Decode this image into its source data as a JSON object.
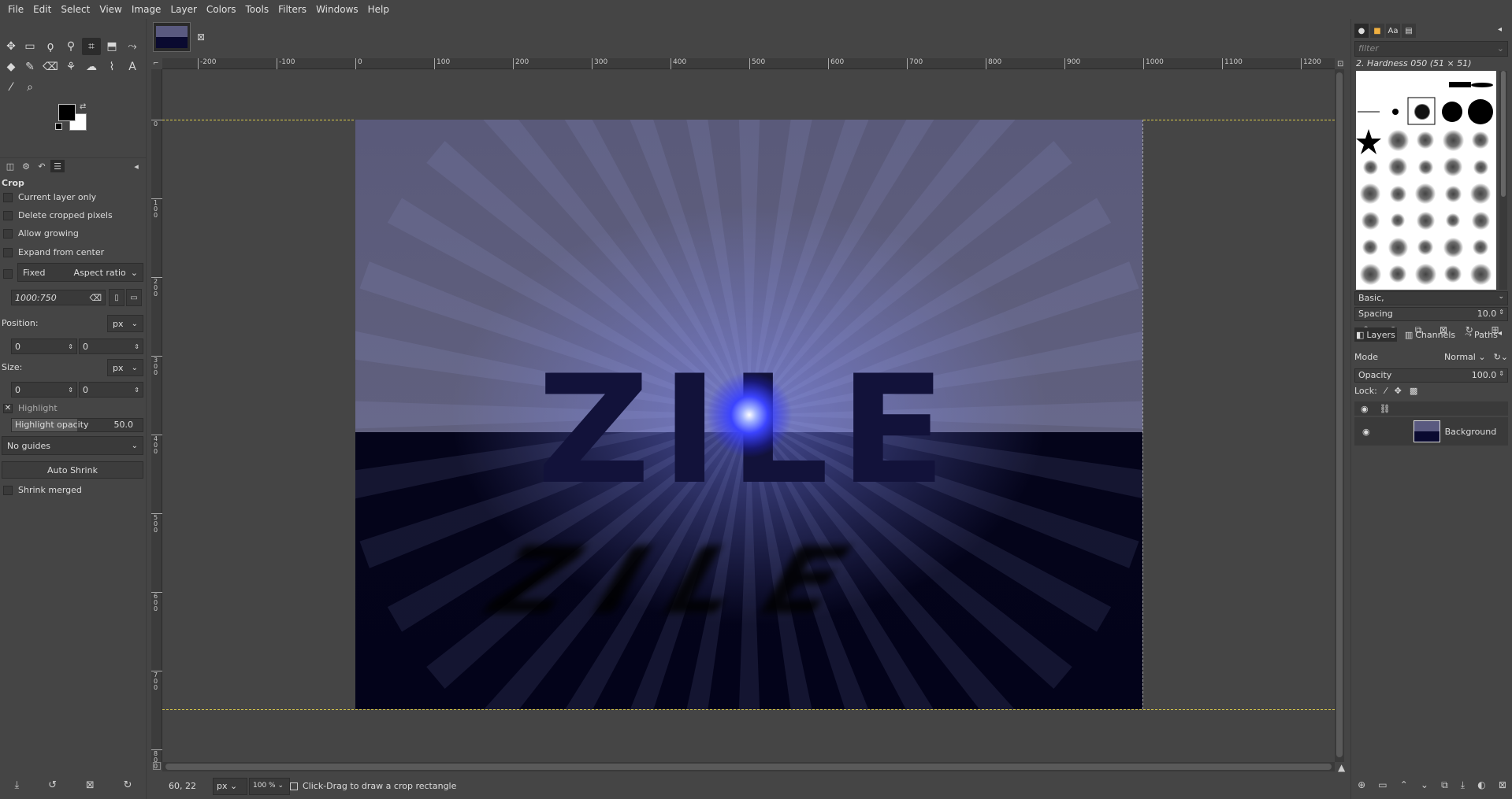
{
  "menu": [
    "File",
    "Edit",
    "Select",
    "View",
    "Image",
    "Layer",
    "Colors",
    "Tools",
    "Filters",
    "Windows",
    "Help"
  ],
  "toolbox": {
    "tool_icons": [
      "move-icon",
      "rect-select-icon",
      "lasso-icon",
      "fuzzy-select-icon",
      "crop-icon",
      "unified-transform-icon",
      "warp-icon",
      "bucket-fill-icon",
      "paintbrush-icon",
      "eraser-icon",
      "clone-icon",
      "smudge-icon",
      "paths-icon",
      "text-icon",
      "color-picker-icon",
      "zoom-icon"
    ],
    "fg_color": "#000000",
    "bg_color": "#ffffff"
  },
  "tool_options": {
    "title": "Crop",
    "current_layer_only": "Current layer only",
    "delete_cropped": "Delete cropped pixels",
    "allow_growing": "Allow growing",
    "expand_from_center": "Expand from center",
    "fixed_label": "Fixed",
    "fixed_mode": "Aspect ratio",
    "aspect_value": "1000:750",
    "position_label": "Position:",
    "position_unit": "px",
    "position_x": "0",
    "position_y": "0",
    "size_label": "Size:",
    "size_unit": "px",
    "size_w": "0",
    "size_h": "0",
    "highlight_label": "Highlight",
    "highlight_opacity_label": "Highlight opacity",
    "highlight_opacity_value": "50.0",
    "highlight_opacity_fraction": 0.5,
    "guides": "No guides",
    "auto_shrink": "Auto Shrink",
    "shrink_merged": "Shrink merged"
  },
  "rulers": {
    "h_labels": [
      "-200",
      "-100",
      "0",
      "100",
      "200",
      "300",
      "400",
      "500",
      "600",
      "700",
      "800",
      "900",
      "1000",
      "1100",
      "1200"
    ],
    "v_labels": [
      "0",
      "100",
      "200",
      "300",
      "400",
      "500",
      "600",
      "700",
      "800"
    ]
  },
  "image": {
    "text": "ZILE"
  },
  "status": {
    "coords": "60, 22",
    "unit": "px",
    "zoom": "100 %",
    "message": "Click-Drag to draw a crop rectangle"
  },
  "brushes": {
    "filter_placeholder": "filter",
    "current": "2. Hardness 050 (51 × 51)",
    "preset": "Basic,",
    "spacing_label": "Spacing",
    "spacing_value": "10.0"
  },
  "layers": {
    "tabs": [
      "Layers",
      "Channels",
      "Paths"
    ],
    "mode_label": "Mode",
    "mode_value": "Normal",
    "opacity_label": "Opacity",
    "opacity_value": "100.0",
    "lock_label": "Lock:",
    "layer_name": "Background"
  }
}
